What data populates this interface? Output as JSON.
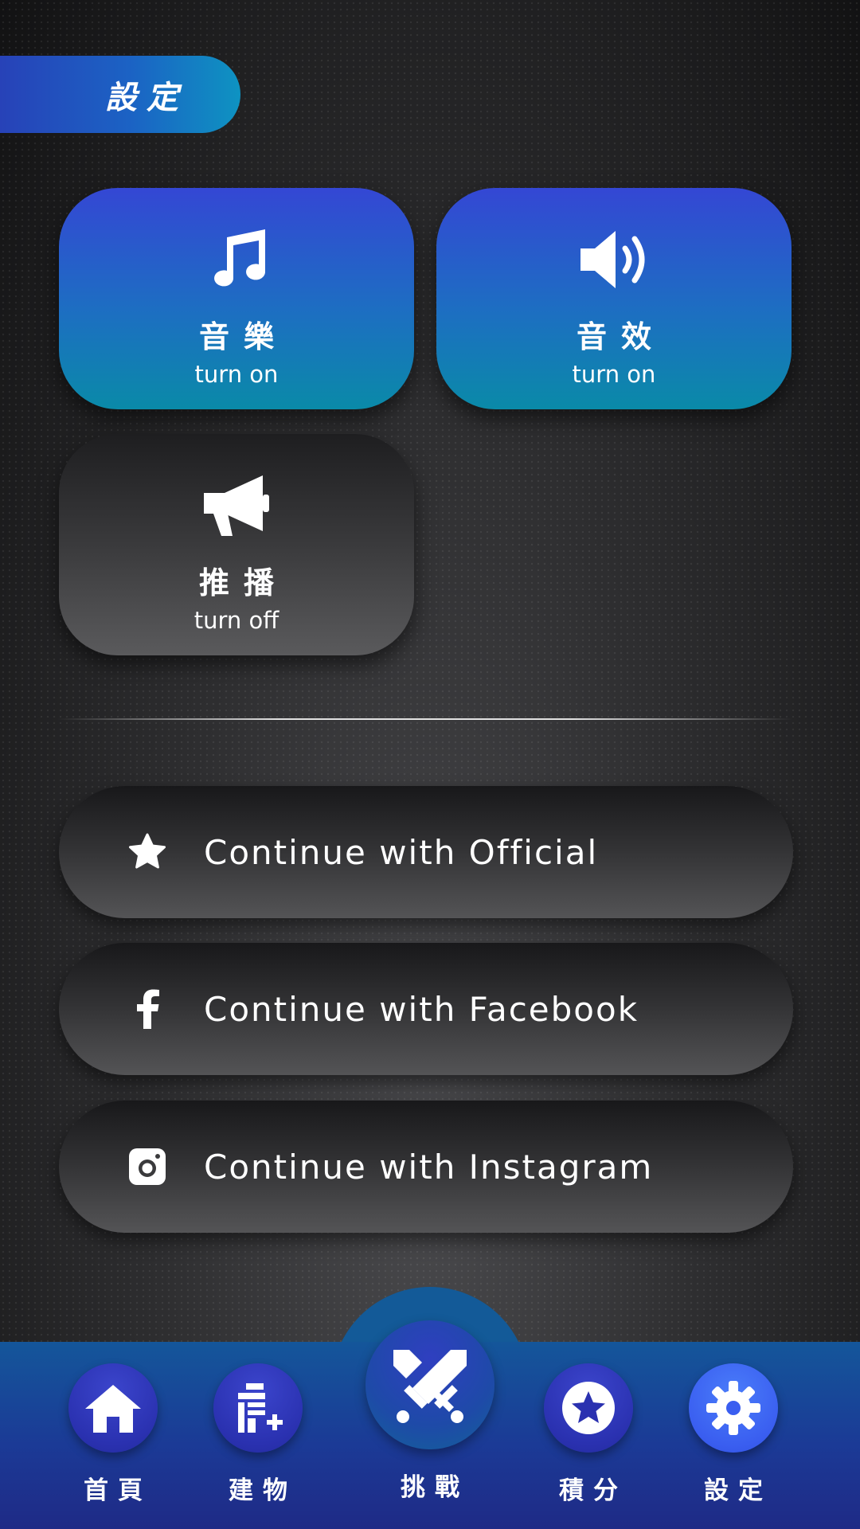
{
  "header": {
    "title": "設定"
  },
  "toggles": [
    {
      "icon": "music-note-icon",
      "label": "音樂",
      "state": "turn on"
    },
    {
      "icon": "speaker-icon",
      "label": "音效",
      "state": "turn on"
    },
    {
      "icon": "megaphone-icon",
      "label": "推播",
      "state": "turn off"
    }
  ],
  "login": [
    {
      "icon": "star-icon",
      "label": "Continue with Official"
    },
    {
      "icon": "facebook-icon",
      "label": "Continue with Facebook"
    },
    {
      "icon": "instagram-icon",
      "label": "Continue with Instagram"
    }
  ],
  "nav": {
    "items": [
      {
        "icon": "home-icon",
        "label": "首頁"
      },
      {
        "icon": "building-add-icon",
        "label": "建物"
      },
      {
        "icon": "crossed-swords-icon",
        "label": "挑戰"
      },
      {
        "icon": "star-badge-icon",
        "label": "積分"
      },
      {
        "icon": "gear-icon",
        "label": "設定"
      }
    ],
    "active_index": 4
  },
  "colors": {
    "toggle_on_top": "#3447d4",
    "toggle_on_bottom": "#0a8aa8",
    "nav_bar": "#1b3a96",
    "nav_active": "#3a5ef0"
  }
}
